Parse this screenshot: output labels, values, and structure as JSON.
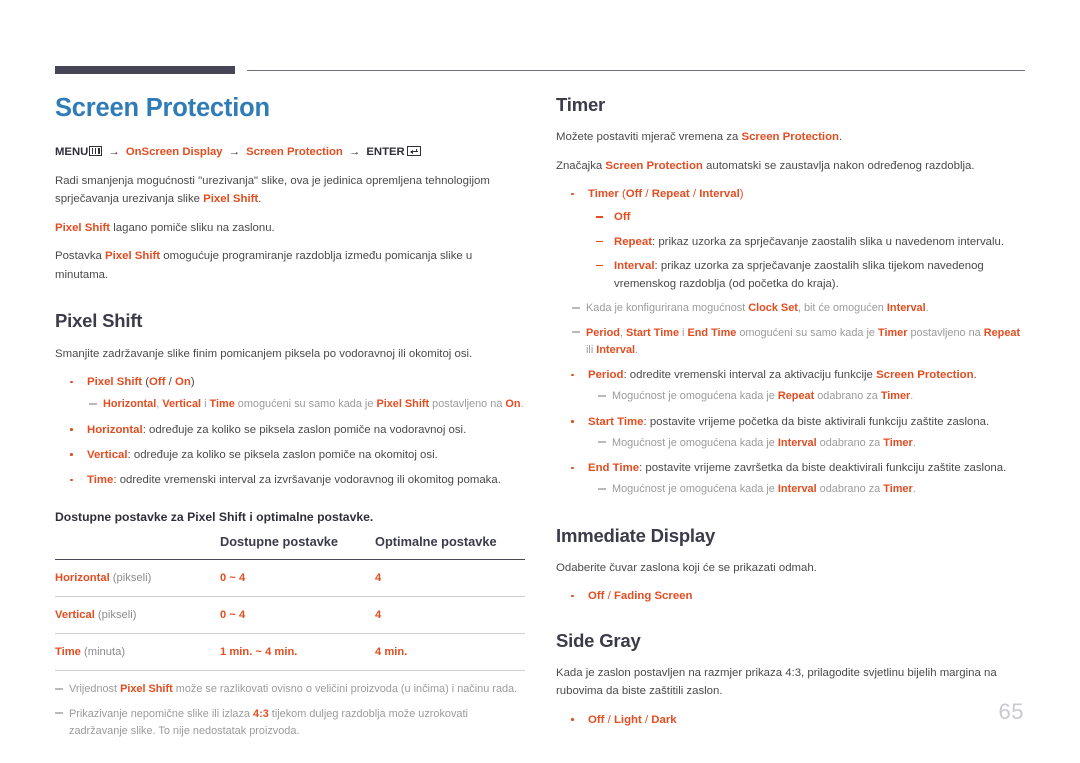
{
  "page_number": "65",
  "colors": {
    "title_blue": "#2f7cb8",
    "accent_orange": "#e24d21",
    "heading_dark": "#3b3b4a",
    "body_gray": "#4a4a4a",
    "note_gray": "#9b9b9b",
    "rule_dark": "#454556"
  },
  "left": {
    "doc_title": "Screen Protection",
    "menu_path": {
      "menu_label": "MENU",
      "menu_icon": "menu-bars-icon",
      "arrow": "→",
      "step1": "OnScreen Display",
      "step2": "Screen Protection",
      "enter_label": "ENTER",
      "enter_icon": "enter-return-icon"
    },
    "intro": {
      "p1_a": "Radi smanjenja mogućnosti \"urezivanja\" slike, ova je jedinica opremljena tehnologijom sprječavanja urezivanja slike ",
      "p1_hl": "Pixel Shift",
      "p1_b": ".",
      "p2_hl": "Pixel Shift",
      "p2_b": " lagano pomiče sliku na zaslonu.",
      "p3_a": "Postavka ",
      "p3_hl": "Pixel Shift",
      "p3_b": " omogućuje programiranje razdoblja između pomicanja slike u minutama."
    },
    "pixel_shift": {
      "title": "Pixel Shift",
      "desc": "Smanjite zadržavanje slike finim pomicanjem piksela po vodoravnoj ili okomitoj osi.",
      "bullets": [
        {
          "label": "Pixel Shift",
          "options_open": " (",
          "opt1": "Off",
          "sep": " / ",
          "opt2": "On",
          "options_close": ")",
          "note": {
            "a": "Horizontal",
            "b": ", ",
            "c": "Vertical",
            "d": " i ",
            "e": "Time",
            "f": " omogućeni su samo kada je ",
            "g": "Pixel Shift",
            "h": " postavljeno na ",
            "i": "On",
            "j": "."
          }
        },
        {
          "label": "Horizontal",
          "text": ": određuje za koliko se piksela zaslon pomiče na vodoravnoj osi."
        },
        {
          "label": "Vertical",
          "text": ": određuje za koliko se piksela zaslon pomiče na okomitoj osi."
        },
        {
          "label": "Time",
          "text": ": odredite vremenski interval za izvršavanje vodoravnog ili okomitog pomaka."
        }
      ]
    },
    "table": {
      "caption": "Dostupne postavke za Pixel Shift i optimalne postavke.",
      "headers": [
        "",
        "Dostupne postavke",
        "Optimalne postavke"
      ],
      "rows": [
        {
          "name": "Horizontal",
          "unit": " (pikseli)",
          "available": "0 ~ 4",
          "optimal": "4"
        },
        {
          "name": "Vertical",
          "unit": " (pikseli)",
          "available": "0 ~ 4",
          "optimal": "4"
        },
        {
          "name": "Time",
          "unit": " (minuta)",
          "available": "1 min. ~ 4 min.",
          "optimal": "4 min."
        }
      ]
    },
    "table_notes": [
      {
        "a": "Vrijednost ",
        "hl": "Pixel Shift",
        "b": " može se razlikovati ovisno o veličini proizvoda (u inčima) i načinu rada."
      },
      {
        "a": "Prikazivanje nepomične slike ili izlaza ",
        "hl": "4:3",
        "b": " tijekom duljeg razdoblja može uzrokovati zadržavanje slike. To nije nedostatak proizvoda."
      }
    ]
  },
  "right": {
    "timer": {
      "title": "Timer",
      "p1_a": "Možete postaviti mjerač vremena za ",
      "p1_hl": "Screen Protection",
      "p1_b": ".",
      "p2_a": "Značajka ",
      "p2_hl": "Screen Protection",
      "p2_b": " automatski se zaustavlja nakon određenog razdoblja.",
      "timer_bullet": {
        "label": "Timer",
        "open": " (",
        "opt1": "Off",
        "sep1": " / ",
        "opt2": "Repeat",
        "sep2": " / ",
        "opt3": "Interval",
        "close": ")"
      },
      "sub_items": [
        {
          "label": "Off",
          "text": ""
        },
        {
          "label": "Repeat",
          "text": ": prikaz uzorka za sprječavanje zaostalih slika u navedenom intervalu."
        },
        {
          "label": "Interval",
          "text": ": prikaz uzorka za sprječavanje zaostalih slika tijekom navedenog vremenskog razdoblja (od početka do kraja)."
        }
      ],
      "note_clock": {
        "a": "Kada je konfigurirana mogućnost ",
        "hl1": "Clock Set",
        "b": ", bit će omogućen ",
        "hl2": "Interval",
        "c": "."
      },
      "note_period": {
        "hl1": "Period",
        "a": ", ",
        "hl2": "Start Time",
        "b": " i ",
        "hl3": "End Time",
        "c": " omogućeni su samo kada je ",
        "hl4": "Timer",
        "d": " postavljeno na ",
        "hl5": "Repeat",
        "e": " ili ",
        "hl6": "Interval",
        "f": "."
      },
      "bullets": [
        {
          "label": "Period",
          "text_a": ": odredite vremenski interval za aktivaciju funkcije ",
          "text_hl": "Screen Protection",
          "text_b": ".",
          "note": {
            "a": "Mogućnost je omogućena kada je ",
            "hl1": "Repeat",
            "b": " odabrano za ",
            "hl2": "Timer",
            "c": "."
          }
        },
        {
          "label": "Start Time",
          "text_a": ": postavite vrijeme početka da biste aktivirali funkciju zaštite zaslona.",
          "text_hl": "",
          "text_b": "",
          "note": {
            "a": "Mogućnost je omogućena kada je ",
            "hl1": "Interval",
            "b": " odabrano za ",
            "hl2": "Timer",
            "c": "."
          }
        },
        {
          "label": "End Time",
          "text_a": ": postavite vrijeme završetka da biste deaktivirali funkciju zaštite zaslona.",
          "text_hl": "",
          "text_b": "",
          "note": {
            "a": "Mogućnost je omogućena kada je ",
            "hl1": "Interval",
            "b": " odabrano za ",
            "hl2": "Timer",
            "c": "."
          }
        }
      ]
    },
    "immediate_display": {
      "title": "Immediate Display",
      "desc": "Odaberite čuvar zaslona koji će se prikazati odmah.",
      "options": {
        "opt1": "Off",
        "sep": " / ",
        "opt2": "Fading Screen"
      }
    },
    "side_gray": {
      "title": "Side Gray",
      "desc": "Kada je zaslon postavljen na razmjer prikaza 4:3, prilagodite svjetlinu bijelih margina na rubovima da biste zaštitili zaslon.",
      "options": {
        "opt1": "Off",
        "sep1": " / ",
        "opt2": "Light",
        "sep2": " / ",
        "opt3": "Dark"
      }
    }
  }
}
